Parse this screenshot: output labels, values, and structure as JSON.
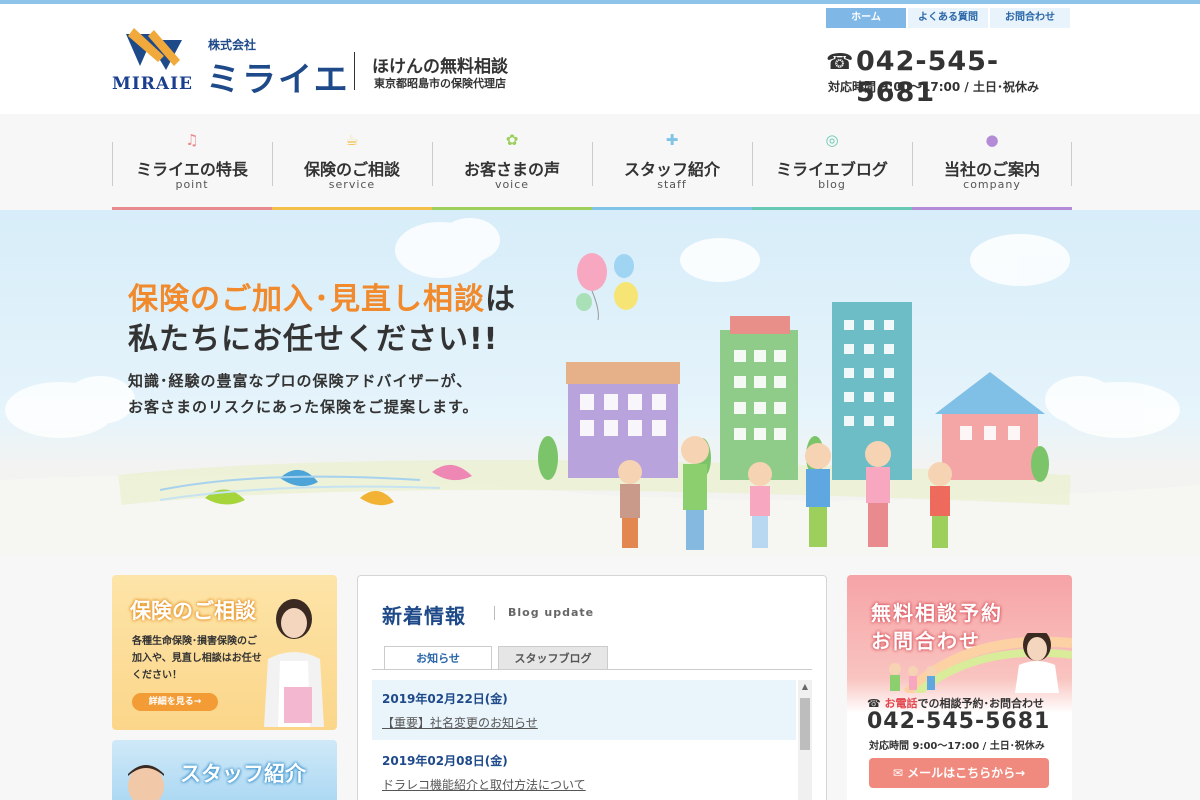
{
  "header": {
    "logo_text": "MIRAIE",
    "company_prefix": "株式会社",
    "company_name": "ミライエ",
    "tagline_main": "ほけんの無料相談",
    "tagline_sub": "東京都昭島市の保険代理店",
    "util_links": [
      "ホーム",
      "よくある質問",
      "お問合わせ"
    ],
    "phone": "042-545-5681",
    "hours": "対応時間 9:00〜17:00 / 土日･祝休み"
  },
  "nav": [
    {
      "label": "ミライエの特長",
      "sub": "point",
      "icon": "music-note-icon",
      "color": "#e98a8f"
    },
    {
      "label": "保険のご相談",
      "sub": "service",
      "icon": "coffee-cup-icon",
      "color": "#f2c04a"
    },
    {
      "label": "お客さまの声",
      "sub": "voice",
      "icon": "tulip-icon",
      "color": "#9ccf5c"
    },
    {
      "label": "スタッフ紹介",
      "sub": "staff",
      "icon": "puzzle-icon",
      "color": "#7fc3e6"
    },
    {
      "label": "ミライエブログ",
      "sub": "blog",
      "icon": "lollipop-icon",
      "color": "#67c9b4"
    },
    {
      "label": "当社のご案内",
      "sub": "company",
      "icon": "planet-icon",
      "color": "#b48bd6"
    }
  ],
  "hero": {
    "line1_highlight": "保険のご加入･見直し相談",
    "line1_rest": "は",
    "line2": "私たちにお任せください!!",
    "desc1": "知識･経験の豊富なプロの保険アドバイザーが、",
    "desc2": "お客さまのリスクにあった保険をご提案します。"
  },
  "consult_card": {
    "title": "保険のご相談",
    "text": "各種生命保険･損害保険のご加入や、見直し相談はお任せください！",
    "button": "詳細を見る→"
  },
  "staff_card": {
    "title": "スタッフ紹介"
  },
  "news": {
    "title": "新着情報",
    "subtitle": "Blog update",
    "tabs": [
      "お知らせ",
      "スタッフブログ"
    ],
    "items": [
      {
        "date": "2019年02月22日(金)",
        "title": "【重要】社名変更のお知らせ"
      },
      {
        "date": "2019年02月08日(金)",
        "title": "ドラレコ機能紹介と取付方法について"
      }
    ]
  },
  "contact": {
    "title1": "無料相談予約",
    "title2": "お問合わせ",
    "tel_label_highlight": "お電話",
    "tel_label_rest": "での相談予約･お問合わせ",
    "phone": "042-545-5681",
    "hours": "対応時間 9:00〜17:00 / 土日･祝休み",
    "mail_button": "メールはこちらから→"
  }
}
